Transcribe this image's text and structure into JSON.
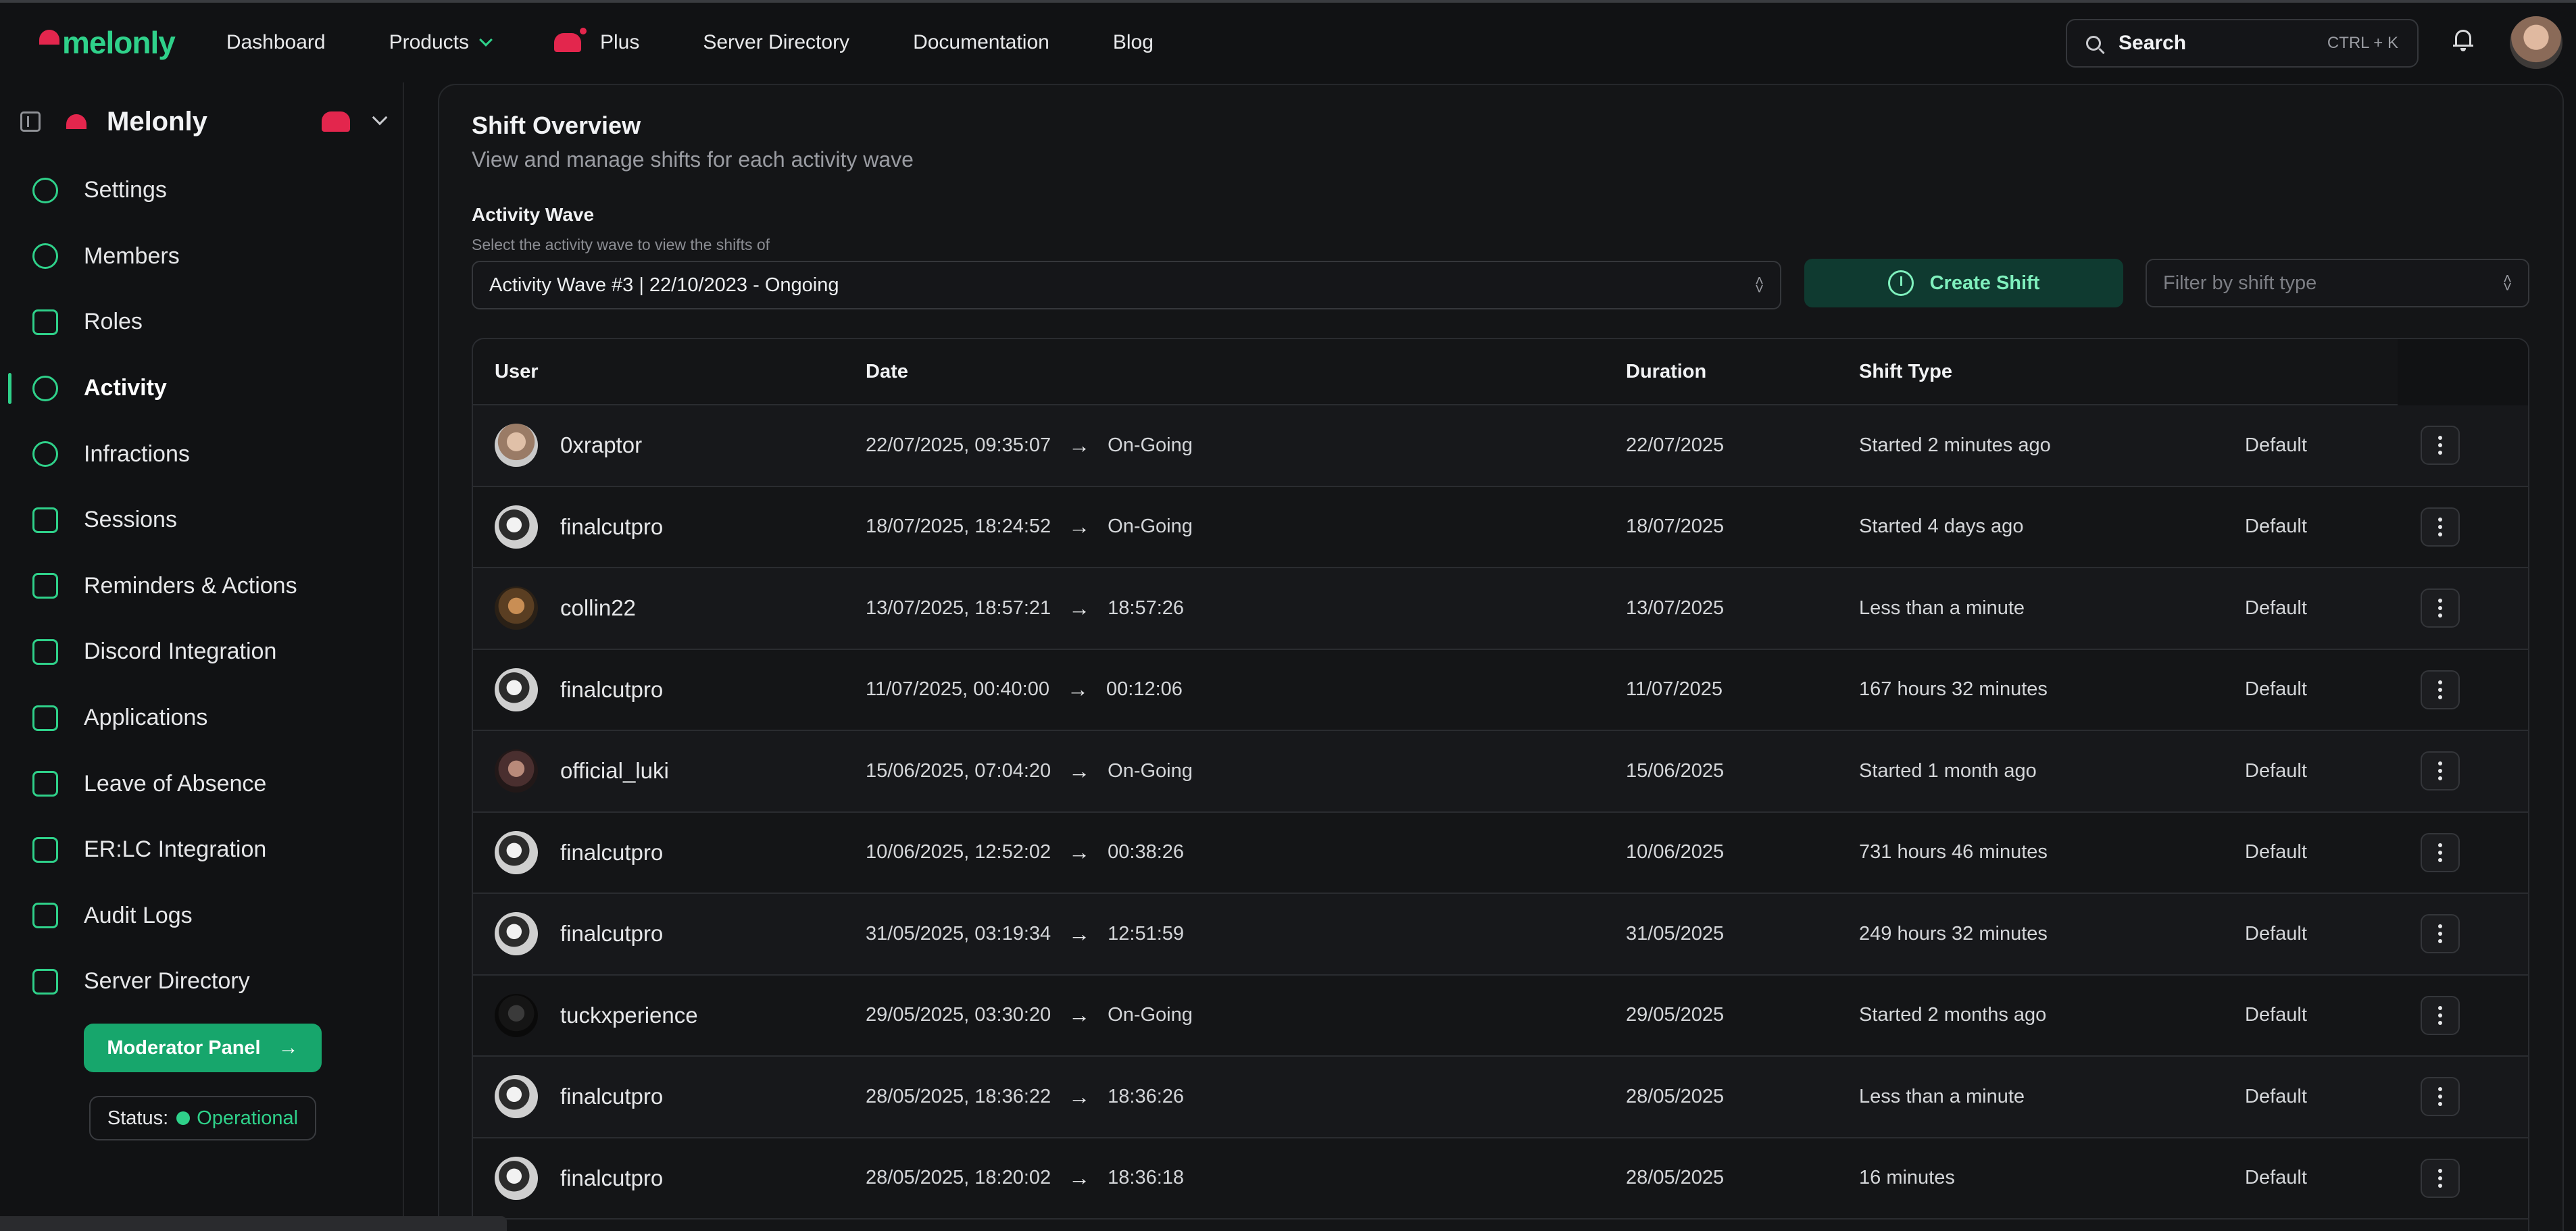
{
  "nav": {
    "logo": "melonly",
    "items": [
      "Dashboard",
      "Products",
      "Plus",
      "Server Directory",
      "Documentation",
      "Blog"
    ],
    "search_label": "Search",
    "search_shortcut": "CTRL + K"
  },
  "sidebar": {
    "server_name": "Melonly",
    "items": [
      {
        "label": "Settings",
        "icon": "gear-icon"
      },
      {
        "label": "Members",
        "icon": "users-icon"
      },
      {
        "label": "Roles",
        "icon": "briefcase-icon"
      },
      {
        "label": "Activity",
        "icon": "clock-icon",
        "active": true
      },
      {
        "label": "Infractions",
        "icon": "scale-icon"
      },
      {
        "label": "Sessions",
        "icon": "monitor-icon"
      },
      {
        "label": "Reminders & Actions",
        "icon": "clipboard-icon"
      },
      {
        "label": "Discord Integration",
        "icon": "discord-icon"
      },
      {
        "label": "Applications",
        "icon": "form-icon"
      },
      {
        "label": "Leave of Absence",
        "icon": "calendar-icon"
      },
      {
        "label": "ER:LC Integration",
        "icon": "gamepad-icon"
      },
      {
        "label": "Audit Logs",
        "icon": "search-doc-icon"
      },
      {
        "label": "Server Directory",
        "icon": "copy-icon"
      }
    ],
    "moderator_button": "Moderator Panel",
    "status_label": "Status:",
    "status_value": "Operational"
  },
  "main": {
    "title": "Shift Overview",
    "subtitle": "View and manage shifts for each activity wave",
    "wave_label": "Activity Wave",
    "wave_help": "Select the activity wave to view the shifts of",
    "wave_selected": "Activity Wave #3 | 22/10/2023 - Ongoing",
    "create_button": "Create Shift",
    "filter_placeholder": "Filter by shift type"
  },
  "table": {
    "headers": {
      "user": "User",
      "date": "Date",
      "duration": "Duration",
      "shift_type": "Shift Type"
    },
    "rows": [
      {
        "user": "0xraptor",
        "start": "22/07/2025, 09:35:07",
        "end": "On-Going",
        "duration": "22/07/2025",
        "shift_type": "Started 2 minutes ago",
        "type": "Default"
      },
      {
        "user": "finalcutpro",
        "start": "18/07/2025, 18:24:52",
        "end": "On-Going",
        "duration": "18/07/2025",
        "shift_type": "Started 4 days ago",
        "type": "Default"
      },
      {
        "user": "collin22",
        "start": "13/07/2025, 18:57:21",
        "end": "18:57:26",
        "duration": "13/07/2025",
        "shift_type": "Less than a minute",
        "type": "Default"
      },
      {
        "user": "finalcutpro",
        "start": "11/07/2025, 00:40:00",
        "end": "00:12:06",
        "duration": "11/07/2025",
        "shift_type": "167 hours 32 minutes",
        "type": "Default"
      },
      {
        "user": "official_luki",
        "start": "15/06/2025, 07:04:20",
        "end": "On-Going",
        "duration": "15/06/2025",
        "shift_type": "Started 1 month ago",
        "type": "Default"
      },
      {
        "user": "finalcutpro",
        "start": "10/06/2025, 12:52:02",
        "end": "00:38:26",
        "duration": "10/06/2025",
        "shift_type": "731 hours 46 minutes",
        "type": "Default"
      },
      {
        "user": "finalcutpro",
        "start": "31/05/2025, 03:19:34",
        "end": "12:51:59",
        "duration": "31/05/2025",
        "shift_type": "249 hours 32 minutes",
        "type": "Default"
      },
      {
        "user": "tuckxperience",
        "start": "29/05/2025, 03:30:20",
        "end": "On-Going",
        "duration": "29/05/2025",
        "shift_type": "Started 2 months ago",
        "type": "Default"
      },
      {
        "user": "finalcutpro",
        "start": "28/05/2025, 18:36:22",
        "end": "18:36:26",
        "duration": "28/05/2025",
        "shift_type": "Less than a minute",
        "type": "Default"
      },
      {
        "user": "finalcutpro",
        "start": "28/05/2025, 18:20:02",
        "end": "18:36:18",
        "duration": "28/05/2025",
        "shift_type": "16 minutes",
        "type": "Default"
      }
    ]
  }
}
